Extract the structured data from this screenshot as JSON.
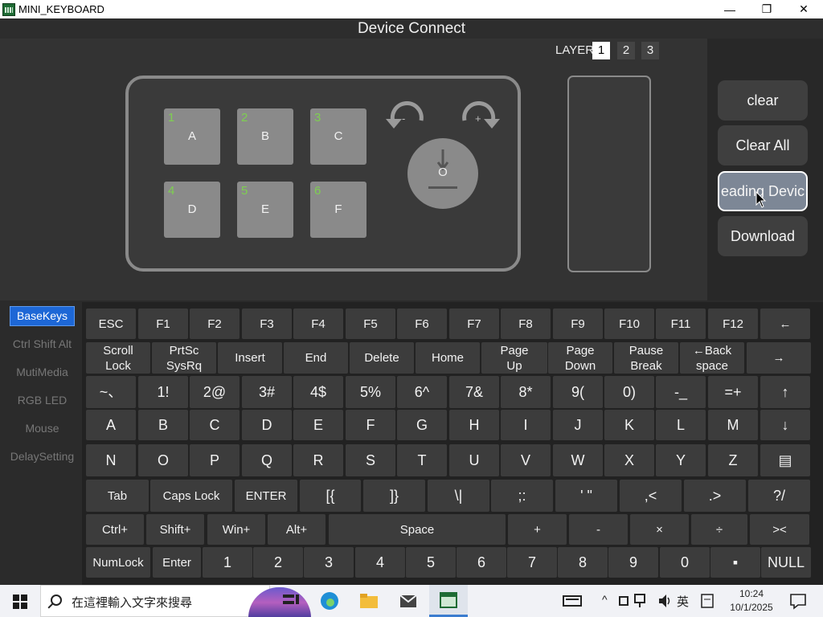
{
  "window": {
    "title": "MINI_KEYBOARD",
    "minimize": "—",
    "maximize": "❐",
    "close": "✕"
  },
  "header": {
    "title": "Device Connect"
  },
  "layer": {
    "label": "LAYER",
    "buttons": [
      "1",
      "2",
      "3"
    ],
    "active": "1"
  },
  "device": {
    "keys": [
      {
        "num": "1",
        "label": "A"
      },
      {
        "num": "2",
        "label": "B"
      },
      {
        "num": "3",
        "label": "C"
      },
      {
        "num": "4",
        "label": "D"
      },
      {
        "num": "5",
        "label": "E"
      },
      {
        "num": "6",
        "label": "F"
      }
    ],
    "knob_label": "O",
    "rotate_left": "-",
    "rotate_right": "+"
  },
  "actions": {
    "clear": "clear",
    "clear_all": "Clear All",
    "reading": "eading Devic",
    "download": "Download"
  },
  "categories": [
    "BaseKeys",
    "Ctrl Shift Alt",
    "MutiMedia",
    "RGB LED",
    "Mouse",
    "DelaySetting"
  ],
  "keyboard": {
    "row1": [
      "ESC",
      "F1",
      "F2",
      "F3",
      "F4",
      "F5",
      "F6",
      "F7",
      "F8",
      "F9",
      "F10",
      "F11",
      "F12",
      "←"
    ],
    "row2": [
      "Scroll\nLock",
      "PrtSc\nSysRq",
      "Insert",
      "End",
      "Delete",
      "Home",
      "Page\nUp",
      "Page\nDown",
      "Pause\nBreak",
      "←Back\nspace",
      "→"
    ],
    "row3": [
      "~、",
      "1!",
      "2@",
      "3#",
      "4$",
      "5%",
      "6^",
      "7&",
      "8*",
      "9(",
      "0)",
      "-_",
      "=+",
      "↑"
    ],
    "row4": [
      "A",
      "B",
      "C",
      "D",
      "E",
      "F",
      "G",
      "H",
      "I",
      "J",
      "K",
      "L",
      "M",
      "↓"
    ],
    "row5": [
      "N",
      "O",
      "P",
      "Q",
      "R",
      "S",
      "T",
      "U",
      "V",
      "W",
      "X",
      "Y",
      "Z",
      "▤"
    ],
    "row6": [
      "Tab",
      "Caps Lock",
      "ENTER",
      "[{",
      "]}",
      "\\|",
      ";:",
      "' \"",
      ",<",
      ".>",
      "?/"
    ],
    "row7": [
      "Ctrl+",
      "Shift+",
      "Win+",
      "Alt+",
      "Space",
      "+",
      "-",
      "×",
      "÷",
      "><"
    ],
    "row8": [
      "NumLock",
      "Enter",
      "1",
      "2",
      "3",
      "4",
      "5",
      "6",
      "7",
      "8",
      "9",
      "0",
      "▪",
      "NULL"
    ]
  },
  "taskbar": {
    "search_placeholder": "在這裡輸入文字來搜尋",
    "ime": "英",
    "time": "10:24",
    "date": "10/1/2025"
  }
}
